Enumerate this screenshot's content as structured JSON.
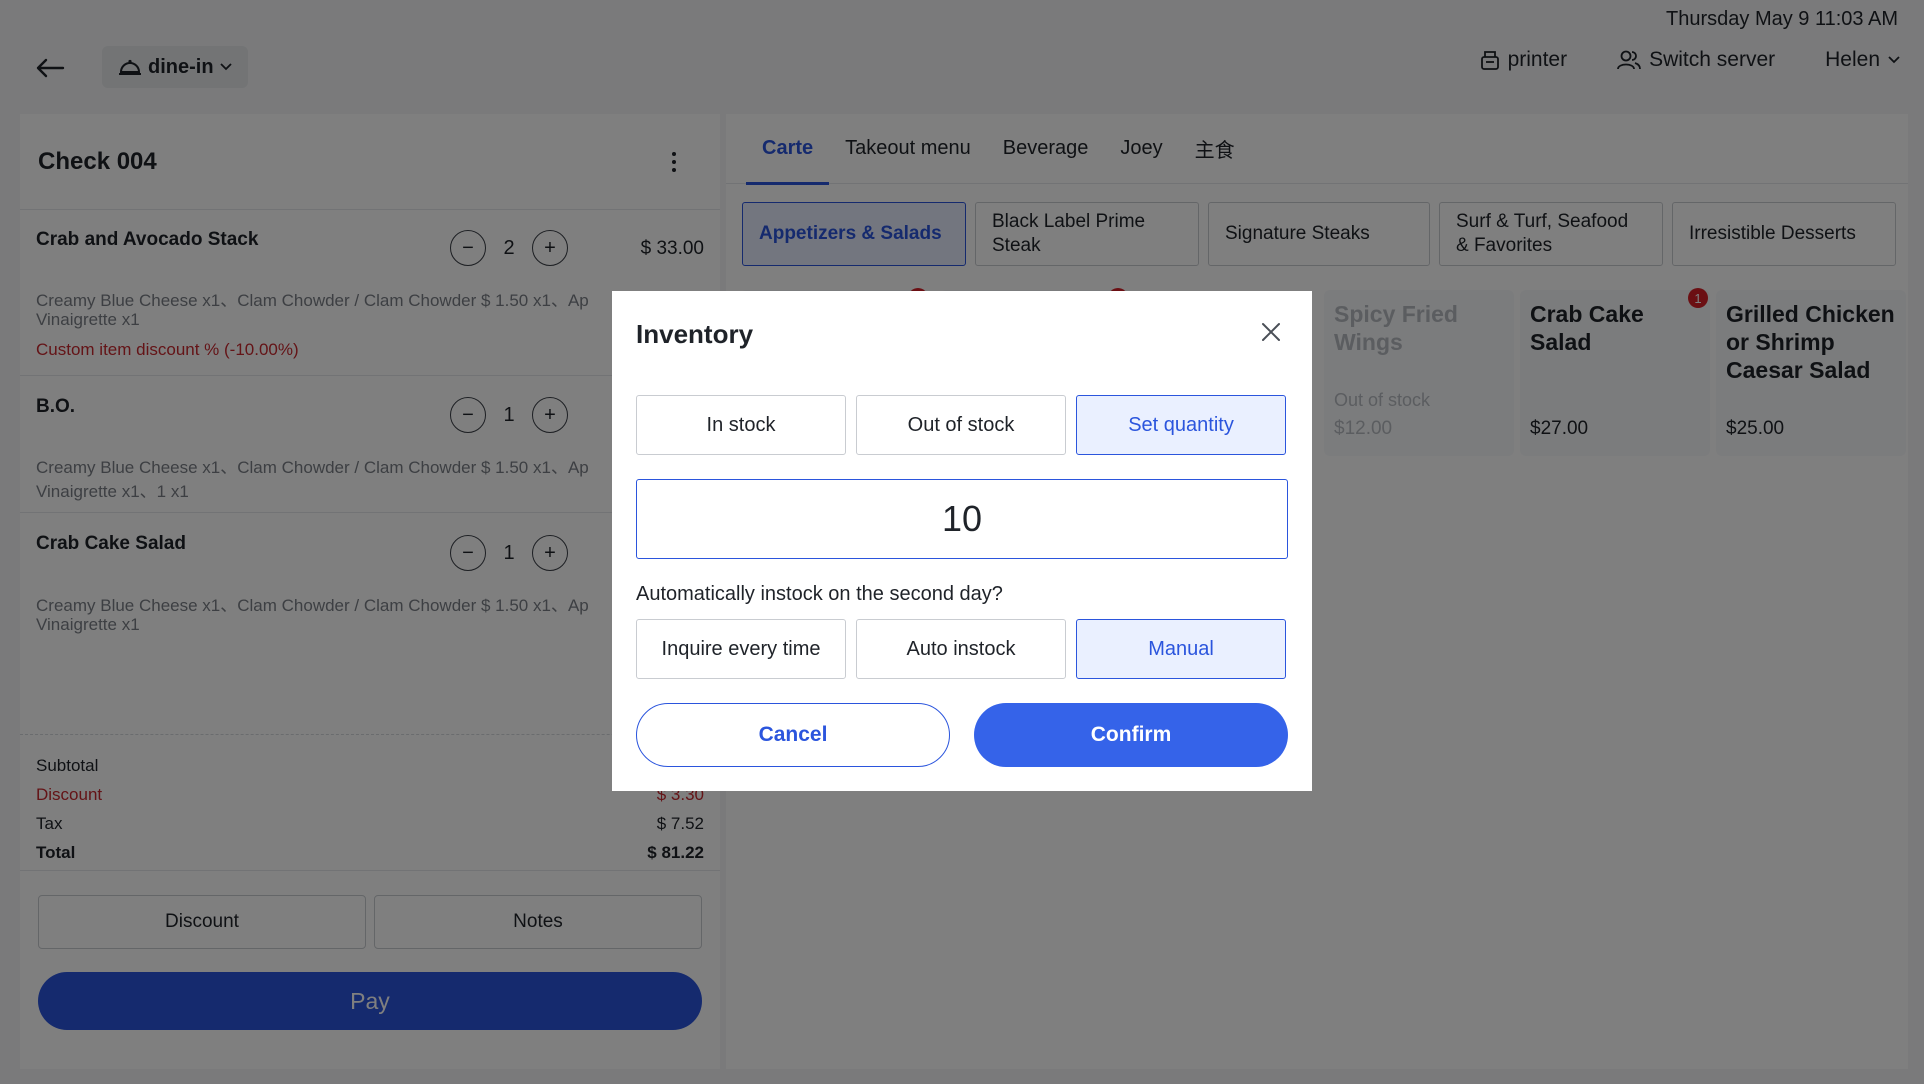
{
  "status_bar": {
    "datetime": "Thursday May 9 11:03 AM"
  },
  "topbar": {
    "mode_label": "dine-in",
    "printer_label": "printer",
    "switch_server_label": "Switch server",
    "user_name": "Helen"
  },
  "check": {
    "title": "Check 004",
    "items": [
      {
        "name": "Crab and Avocado Stack",
        "qty": "2",
        "price": "$ 33.00",
        "modifiers_line1": "Creamy Blue Cheese x1、Clam Chowder / Clam Chowder $ 1.50 x1、Ap",
        "modifiers_line2": "Vinaigrette x1",
        "discount": "Custom item discount % (-10.00%)"
      },
      {
        "name": "B.O.",
        "qty": "1",
        "modifiers_line1": "Creamy Blue Cheese x1、Clam Chowder / Clam Chowder $ 1.50 x1、Ap",
        "modifiers_line2": "Vinaigrette x1、1 x1"
      },
      {
        "name": "Crab Cake Salad",
        "qty": "1",
        "modifiers_line1": "Creamy Blue Cheese x1、Clam Chowder / Clam Chowder $ 1.50 x1、Ap",
        "modifiers_line2": "Vinaigrette x1"
      }
    ],
    "summary": {
      "subtotal_label": "Subtotal",
      "discount_label": "Discount",
      "discount_value": "$ 3.30",
      "tax_label": "Tax",
      "tax_value": "$ 7.52",
      "total_label": "Total",
      "total_value": "$ 81.22"
    },
    "discount_button": "Discount",
    "notes_button": "Notes",
    "pay_button": "Pay"
  },
  "menu": {
    "tabs": [
      "Carte",
      "Takeout menu",
      "Beverage",
      "Joey",
      "主食"
    ],
    "active_tab": "Carte",
    "categories": [
      "Appetizers & Salads",
      "Black Label Prime Steak",
      "Signature Steaks",
      "Surf & Turf, Seafood & Favorites",
      "Irresistible Desserts"
    ],
    "dishes": [
      {
        "name": "Spicy Fried Wings",
        "status": "Out of stock",
        "price": "$12.00"
      },
      {
        "name": "Crab Cake Salad",
        "price": "$27.00",
        "badge": "1"
      },
      {
        "name": "Grilled Chicken or Shrimp Caesar Salad",
        "price": "$25.00"
      }
    ]
  },
  "modal": {
    "title": "Inventory",
    "stock_options": [
      "In stock",
      "Out of stock",
      "Set quantity"
    ],
    "selected_stock_option": "Set quantity",
    "quantity_value": "10",
    "question": "Automatically instock on the second day?",
    "instock_options": [
      "Inquire every time",
      "Auto instock",
      "Manual"
    ],
    "selected_instock_option": "Manual",
    "cancel_label": "Cancel",
    "confirm_label": "Confirm"
  },
  "colors": {
    "accent": "#2b55dd",
    "danger": "#c8282f",
    "overlay": "rgba(0,0,0,0.5)"
  }
}
